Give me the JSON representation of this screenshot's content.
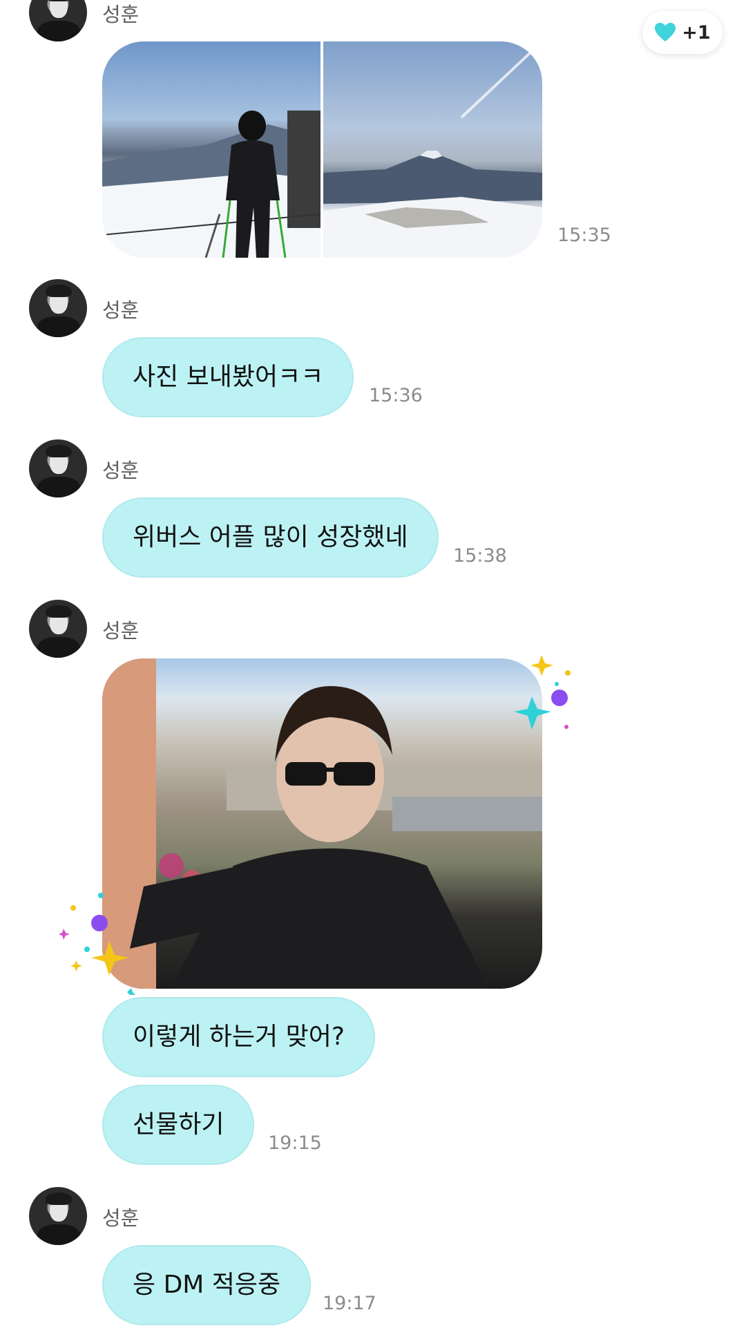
{
  "reaction": {
    "icon": "heart-icon",
    "count": "+1",
    "heart_color": "#3fd3dc"
  },
  "colors": {
    "bubble": "#bdf2f4",
    "bubble_border": "#aee9ec",
    "sender": "#5f5f5f",
    "time": "#8b8b8b"
  },
  "messages": [
    {
      "sender": "성훈",
      "type": "images",
      "time": "15:35"
    },
    {
      "sender": "성훈",
      "text": "사진 보내봤어ㅋㅋ",
      "time": "15:36"
    },
    {
      "sender": "성훈",
      "text": "위버스 어플 많이 성장했네",
      "time": "15:38"
    },
    {
      "sender": "성훈",
      "type": "image",
      "texts": [
        "이렇게 하는거 맞어?",
        "선물하기"
      ],
      "time": "19:15"
    },
    {
      "sender": "성훈",
      "text": "응 DM 적응중",
      "time": "19:17"
    }
  ]
}
